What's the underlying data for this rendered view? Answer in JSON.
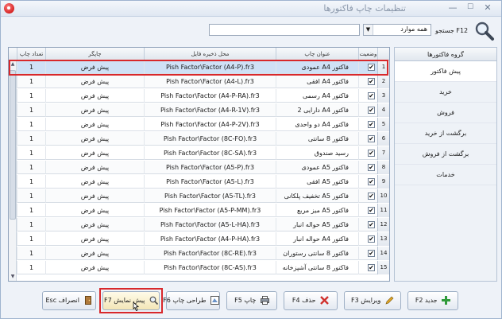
{
  "window": {
    "title": "تنظیمات چاپ فاکتورها",
    "close_glyph": "✕",
    "max_glyph": "☐",
    "min_glyph": "—"
  },
  "search": {
    "label": "جستجو F12",
    "scope_value": "همه موارد",
    "input_value": ""
  },
  "grid": {
    "columns": {
      "status": "وضعیت",
      "title": "عنوان چاپ",
      "path": "محل ذخیره فایل",
      "printer": "چاپگر",
      "copies": "تعداد چاپ"
    },
    "rows": [
      {
        "num": "1",
        "checked": true,
        "title": "فاکتور A4 عمودی",
        "path": "Pish Factor\\Factor (A4-P).fr3",
        "printer": "پیش فرض",
        "copies": "1"
      },
      {
        "num": "2",
        "checked": true,
        "title": "فاکتور A4 افقی",
        "path": "Pish Factor\\Factor (A4-L).fr3",
        "printer": "پیش فرض",
        "copies": "1"
      },
      {
        "num": "3",
        "checked": true,
        "title": "فاکتور A4 رسمی",
        "path": "Pish Factor\\Factor (A4-P-RA).fr3",
        "printer": "پیش فرض",
        "copies": "1"
      },
      {
        "num": "4",
        "checked": true,
        "title": "فاکتور A4 دارایی 2",
        "path": "Pish Factor\\Factor (A4-R-1V).fr3",
        "printer": "پیش فرض",
        "copies": "1"
      },
      {
        "num": "5",
        "checked": true,
        "title": "فاکتور A4 دو واحدی",
        "path": "Pish Factor\\Factor (A4-P-2V).fr3",
        "printer": "پیش فرض",
        "copies": "1"
      },
      {
        "num": "6",
        "checked": true,
        "title": "فاکتور 8 سانتی",
        "path": "Pish Factor\\Factor (8C-FO).fr3",
        "printer": "پیش فرض",
        "copies": "1"
      },
      {
        "num": "7",
        "checked": true,
        "title": "رسید صندوق",
        "path": "Pish Factor\\Factor (8C-SA).fr3",
        "printer": "پیش فرض",
        "copies": "1"
      },
      {
        "num": "8",
        "checked": true,
        "title": "فاکتور A5 عمودی",
        "path": "Pish Factor\\Factor (A5-P).fr3",
        "printer": "پیش فرض",
        "copies": "1"
      },
      {
        "num": "9",
        "checked": true,
        "title": "فاکتور A5 افقی",
        "path": "Pish Factor\\Factor (A5-L).fr3",
        "printer": "پیش فرض",
        "copies": "1"
      },
      {
        "num": "10",
        "checked": true,
        "title": "فاکتور A5 تخفیف پلکانی",
        "path": "Pish Factor\\Factor (A5-TL).fr3",
        "printer": "پیش فرض",
        "copies": "1"
      },
      {
        "num": "11",
        "checked": true,
        "title": "فاکتور A5 میز مربع",
        "path": "Pish Factor\\Factor (A5-P-MM).fr3",
        "printer": "پیش فرض",
        "copies": "1"
      },
      {
        "num": "12",
        "checked": true,
        "title": "فاکتور A5 حواله انبار",
        "path": "Pish Factor\\Factor (A5-L-HA).fr3",
        "printer": "پیش فرض",
        "copies": "1"
      },
      {
        "num": "13",
        "checked": true,
        "title": "فاکتور A4 حواله انبار",
        "path": "Pish Factor\\Factor (A4-P-HA).fr3",
        "printer": "پیش فرض",
        "copies": "1"
      },
      {
        "num": "14",
        "checked": true,
        "title": "فاکتور 8 سانتی رستوران",
        "path": "Pish Factor\\Factor (8C-RE).fr3",
        "printer": "پیش فرض",
        "copies": "1"
      },
      {
        "num": "15",
        "checked": true,
        "title": "فاکتور 8 سانتی آشپزخانه",
        "path": "Pish Factor\\Factor (8C-AS).fr3",
        "printer": "پیش فرض",
        "copies": "1"
      }
    ]
  },
  "groups": {
    "header": "گروه فاکتورها",
    "items": [
      "پیش فاکتور",
      "خرید",
      "فروش",
      "برگشت از خرید",
      "برگشت از فروش",
      "خدمات"
    ]
  },
  "toolbar": {
    "new": "جدید F2",
    "edit": "ویرایش F3",
    "delete": "حذف F4",
    "print": "چاپ F5",
    "design": "طراحی چاپ F6",
    "preview": "پیش نمایش F7",
    "cancel": "انصراف Esc"
  },
  "colors": {
    "accent": "#d8282b",
    "selection": "#cfe1f6",
    "add": "#2f9a3a",
    "delete": "#d0312d"
  }
}
